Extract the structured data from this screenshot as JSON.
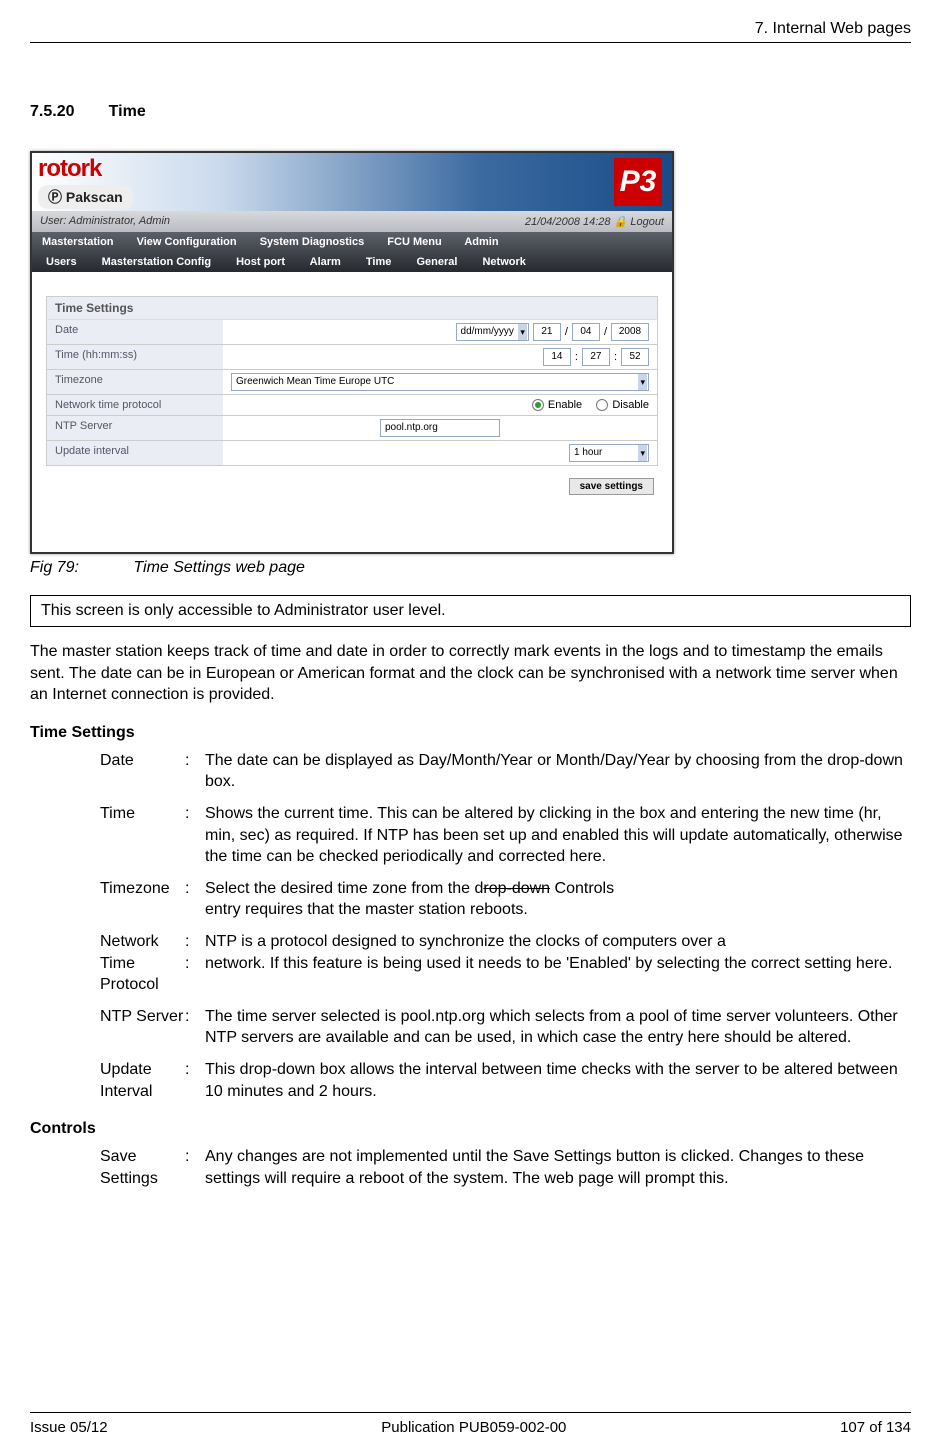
{
  "header": {
    "chapter": "7. Internal Web pages"
  },
  "section": {
    "number": "7.5.20",
    "title": "Time"
  },
  "screenshot": {
    "logo_main": "rotork",
    "logo_sub": "Pakscan",
    "p3": "P3",
    "user_left": "User: Administrator, Admin",
    "user_date": "21/04/2008 14:28",
    "user_logout": "Logout",
    "menu1": [
      "Masterstation",
      "View Configuration",
      "System Diagnostics",
      "FCU Menu",
      "Admin"
    ],
    "menu2": [
      "Users",
      "Masterstation Config",
      "Host port",
      "Alarm",
      "Time",
      "General",
      "Network"
    ],
    "panel_title": "Time Settings",
    "rows": {
      "date_label": "Date",
      "date_format": "dd/mm/yyyy",
      "date_d": "21",
      "date_m": "04",
      "date_y": "2008",
      "time_label": "Time (hh:mm:ss)",
      "time_h": "14",
      "time_m": "27",
      "time_s": "52",
      "tz_label": "Timezone",
      "tz_value": "Greenwich Mean Time Europe UTC",
      "ntp_label": "Network time protocol",
      "ntp_enable": "Enable",
      "ntp_disable": "Disable",
      "ntps_label": "NTP Server",
      "ntps_value": "pool.ntp.org",
      "upd_label": "Update interval",
      "upd_value": "1 hour"
    },
    "save_button": "save settings"
  },
  "figure": {
    "number": "Fig 79:",
    "caption": "Time Settings web page"
  },
  "note": "This screen is only accessible to Administrator user level.",
  "intro": "The master station keeps track of time and date in order to correctly mark events in the logs and to timestamp the emails sent. The date can be in European or American format and the clock can be synchronised with a network time server when an Internet connection is provided.",
  "settings_head": "Time Settings",
  "defs": {
    "date_t": "Date",
    "date_d": "The date can be displayed as Day/Month/Year or Month/Day/Year by choosing from the drop-down box.",
    "time_t": "Time",
    "time_d": "Shows the current time. This can be altered by clicking in the box and entering the new time (hr, min, sec) as required. If NTP has been set up and enabled this will update automatically, otherwise the time can be checked periodically and corrected here.",
    "tz_t": "Timezone",
    "tz_d1": "Select the desired time zone from the d",
    "tz_strike": "rop-down",
    "tz_d2": "  Controls",
    "tz_d3": "entry requires that the master station reboots.",
    "ntp_t1": "Network Time",
    "ntp_t2": "Protocol",
    "ntp_d1": "NTP is a protocol designed to synchronize the clocks of computers over a",
    "ntp_d2": "network. If this feature is being used it needs to be 'Enabled' by selecting the correct setting here.",
    "ntps_t": "NTP Server",
    "ntps_d": "The time server selected is pool.ntp.org which selects from a pool of time server volunteers. Other NTP servers are available and can be used, in which case the entry here should be altered.",
    "upd_t": "Update Interval",
    "upd_d": "This drop-down box allows the interval between time checks with the server to be altered between 10 minutes and 2 hours."
  },
  "controls_head": "Controls",
  "controls": {
    "save_t": "Save Settings",
    "save_d": "Any changes are not implemented until the Save Settings button is clicked. Changes to these settings will require a reboot of the system.  The web page will prompt this."
  },
  "footer": {
    "left": "Issue 05/12",
    "center": "Publication PUB059-002-00",
    "right": "107 of 134"
  }
}
